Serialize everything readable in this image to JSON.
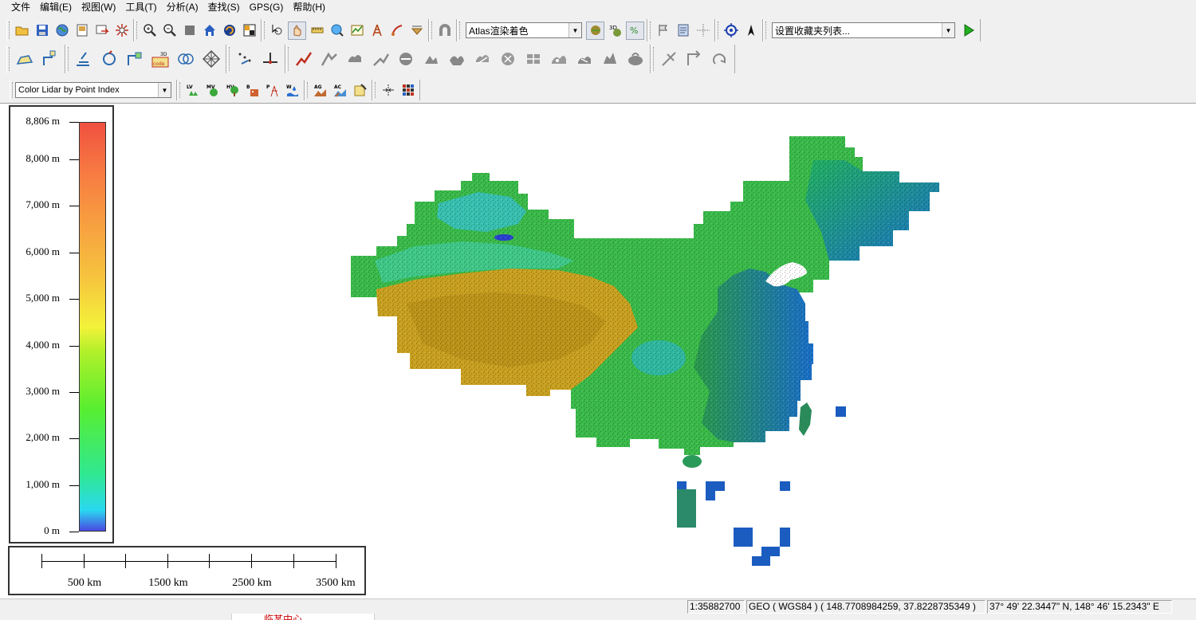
{
  "menu": [
    "文件",
    "编辑(E)",
    "视图(W)",
    "工具(T)",
    "分析(A)",
    "查找(S)",
    "GPS(G)",
    "帮助(H)"
  ],
  "toolbar": {
    "shader_select": "Atlas渲染着色",
    "favorites_select": "设置收藏夹列表...",
    "lidar_select": "Color Lidar by Point Index",
    "lidar_buttons": [
      "LV",
      "MV",
      "HV",
      "B",
      "P",
      "W",
      "AG",
      "AC"
    ]
  },
  "legend": {
    "ticks": [
      "8,806 m",
      "8,000 m",
      "7,000 m",
      "6,000 m",
      "5,000 m",
      "4,000 m",
      "3,000 m",
      "2,000 m",
      "1,000 m",
      "0 m"
    ],
    "values": [
      8806,
      8000,
      7000,
      6000,
      5000,
      4000,
      3000,
      2000,
      1000,
      0
    ],
    "max": 8806,
    "colors": [
      "#4a48e2",
      "#2ad8f0",
      "#58ee30",
      "#f4f23a",
      "#f7a040",
      "#f05040"
    ]
  },
  "scalebar": {
    "labels": [
      "500 km",
      "1500 km",
      "2500 km",
      "3500 km"
    ]
  },
  "status": {
    "scale": "1:35882700",
    "coords": "GEO ( WGS84 ) ( 148.7708984259, 37.8228735349 )",
    "dms": "37° 49' 22.3447\" N, 148° 46' 15.2343\" E"
  },
  "taskbar": {
    "tab_text": "临某中心"
  },
  "colors": {
    "chrome": "#f0f0f0",
    "map_background": "#ffffff"
  }
}
